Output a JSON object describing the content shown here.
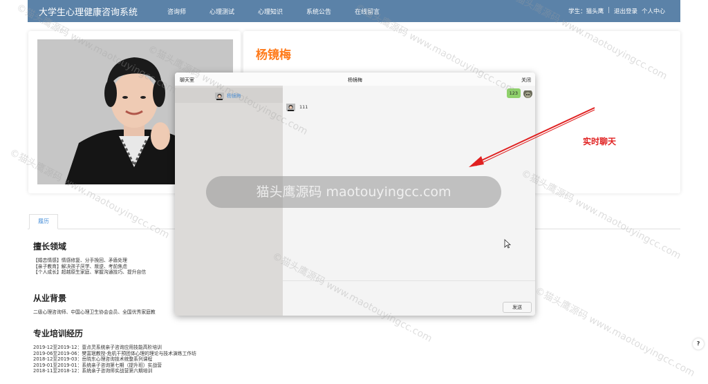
{
  "topbar": {
    "brand": "大学生心理健康咨询系统",
    "nav": [
      "咨询师",
      "心理测试",
      "心理知识",
      "系统公告",
      "在线留言"
    ],
    "user_label": "学生：猫头鹰",
    "separator": "|",
    "logout": "退出登录",
    "profile": "个人中心"
  },
  "doctor": {
    "name": "杨镜梅"
  },
  "tabs": [
    "履历"
  ],
  "sections": {
    "expertise": {
      "title": "擅长领域",
      "lines": [
        "【婚恋情感】情感修复、分手挽回、矛盾处理",
        "【亲子教育】解决孩子厌学、叛逆、考前焦虑",
        "【个人成长】超越原生家庭、掌握沟通技巧、提升自信"
      ]
    },
    "background": {
      "title": "从业背景",
      "lines": [
        "二级心理咨询师、中国心理卫生协会会员、全国优秀家庭教"
      ]
    },
    "training": {
      "title": "专业培训经历",
      "lines": [
        "2019-12至2019-12：壹点灵系统亲子咨询应用技能高阶培训",
        "2019-06至2019-06：樊富珉教授-危机干预团体心理的理论与技术演练工作坊",
        "2018-12至2019-03：岳晓东心理咨询技术统整系列课程",
        "2019-01至2019-01：系统亲子咨询第七期（提升班）实战营",
        "2018-11至2018-12：系统亲子咨询师实战营第六期培训"
      ]
    }
  },
  "chat": {
    "title": "聊天室",
    "peer": "杨镜梅",
    "close": "关闭",
    "contact_name": "杨镜梅",
    "incoming": "111",
    "outgoing": "123",
    "send": "发送"
  },
  "overlay": "猫头鹰源码 maotouyingcc.com",
  "annotation": "实时聊天",
  "help": "?",
  "watermark": "©猫头鹰源码 www.maotouyingcc.com",
  "colors": {
    "nav_bg": "#5b82a8",
    "name": "#ff7a1a",
    "annotation": "#e02020",
    "bubble_out": "#8fd16b"
  }
}
